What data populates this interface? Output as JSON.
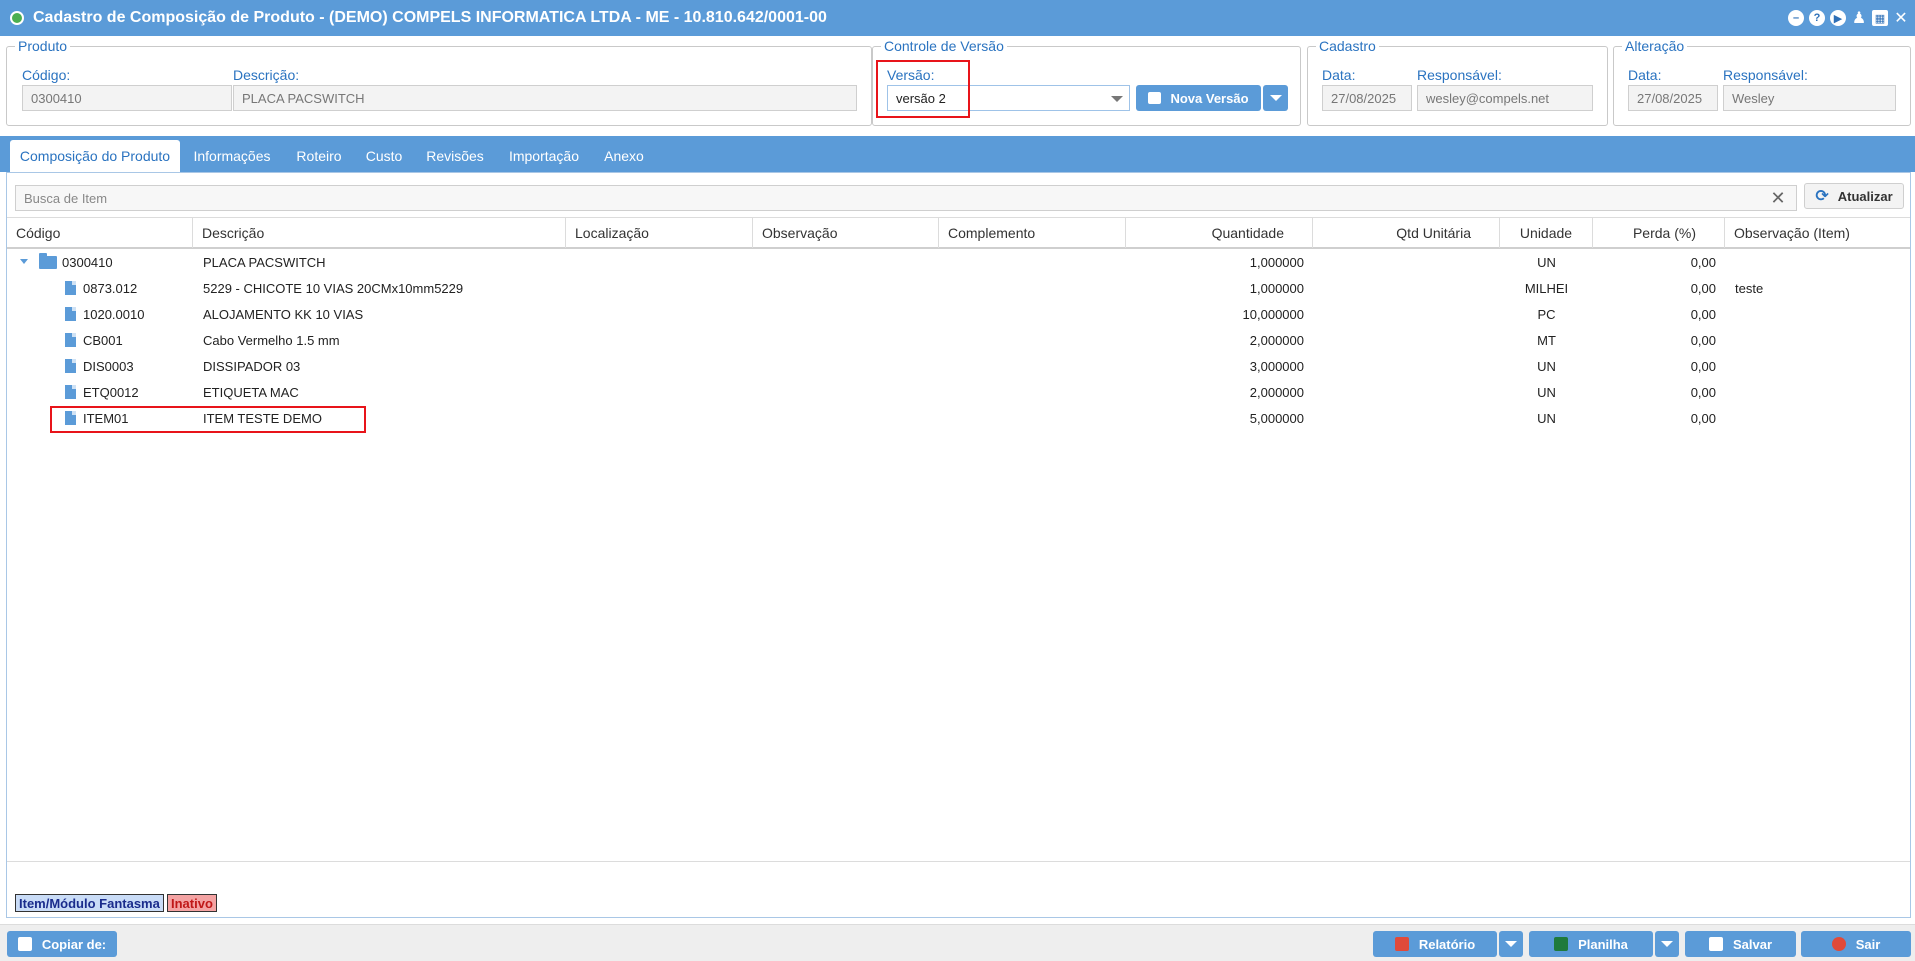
{
  "window": {
    "title": "Cadastro de Composição de Produto - (DEMO) COMPELS INFORMATICA LTDA - ME - 10.810.642/0001-00"
  },
  "produto": {
    "legend": "Produto",
    "codigo_label": "Código:",
    "codigo_value": "0300410",
    "descricao_label": "Descrição:",
    "descricao_value": "PLACA PACSWITCH"
  },
  "versao": {
    "legend": "Controle de Versão",
    "label": "Versão:",
    "selected": "versão 2",
    "nova_versao": "Nova Versão"
  },
  "cadastro": {
    "legend": "Cadastro",
    "data_label": "Data:",
    "data_value": "27/08/2025",
    "responsavel_label": "Responsável:",
    "responsavel_value": "wesley@compels.net"
  },
  "alteracao": {
    "legend": "Alteração",
    "data_label": "Data:",
    "data_value": "27/08/2025",
    "responsavel_label": "Responsável:",
    "responsavel_value": "Wesley"
  },
  "tabs": [
    "Composição do Produto",
    "Informações",
    "Roteiro",
    "Custo",
    "Revisões",
    "Importação",
    "Anexo"
  ],
  "search": {
    "placeholder": "Busca de Item",
    "refresh": "Atualizar"
  },
  "columns": [
    "Código",
    "Descrição",
    "Localização",
    "Observação",
    "Complemento",
    "Quantidade",
    "Qtd Unitária",
    "Unidade",
    "Perda (%)",
    "Observação (Item)"
  ],
  "rows": [
    {
      "codigo": "0300410",
      "descricao": "PLACA PACSWITCH",
      "quantidade": "1,000000",
      "unidade": "UN",
      "perda": "0,00",
      "obs_item": ""
    },
    {
      "codigo": "0873.012",
      "descricao": "5229 - CHICOTE 10 VIAS 20CMx10mm5229",
      "quantidade": "1,000000",
      "unidade": "MILHEI",
      "perda": "0,00",
      "obs_item": "teste"
    },
    {
      "codigo": "1020.0010",
      "descricao": "ALOJAMENTO KK 10 VIAS",
      "quantidade": "10,000000",
      "unidade": "PC",
      "perda": "0,00",
      "obs_item": ""
    },
    {
      "codigo": "CB001",
      "descricao": "Cabo Vermelho 1.5 mm",
      "quantidade": "2,000000",
      "unidade": "MT",
      "perda": "0,00",
      "obs_item": ""
    },
    {
      "codigo": "DIS0003",
      "descricao": "DISSIPADOR 03",
      "quantidade": "3,000000",
      "unidade": "UN",
      "perda": "0,00",
      "obs_item": ""
    },
    {
      "codigo": "ETQ0012",
      "descricao": "ETIQUETA MAC",
      "quantidade": "2,000000",
      "unidade": "UN",
      "perda": "0,00",
      "obs_item": ""
    },
    {
      "codigo": "ITEM01",
      "descricao": "ITEM TESTE DEMO",
      "quantidade": "5,000000",
      "unidade": "UN",
      "perda": "0,00",
      "obs_item": ""
    }
  ],
  "legend_badges": {
    "fantasma": "Item/Módulo Fantasma",
    "inativo": "Inativo"
  },
  "bottom": {
    "copiar": "Copiar de:",
    "relatorio": "Relatório",
    "planilha": "Planilha",
    "salvar": "Salvar",
    "sair": "Sair"
  },
  "colors": {
    "primary": "#5b9bd8",
    "label_blue": "#2a73c0",
    "highlight_red": "#e8141a",
    "fantasma_bg": "#c9dcf7",
    "inativo_bg": "#f4a3a3"
  }
}
